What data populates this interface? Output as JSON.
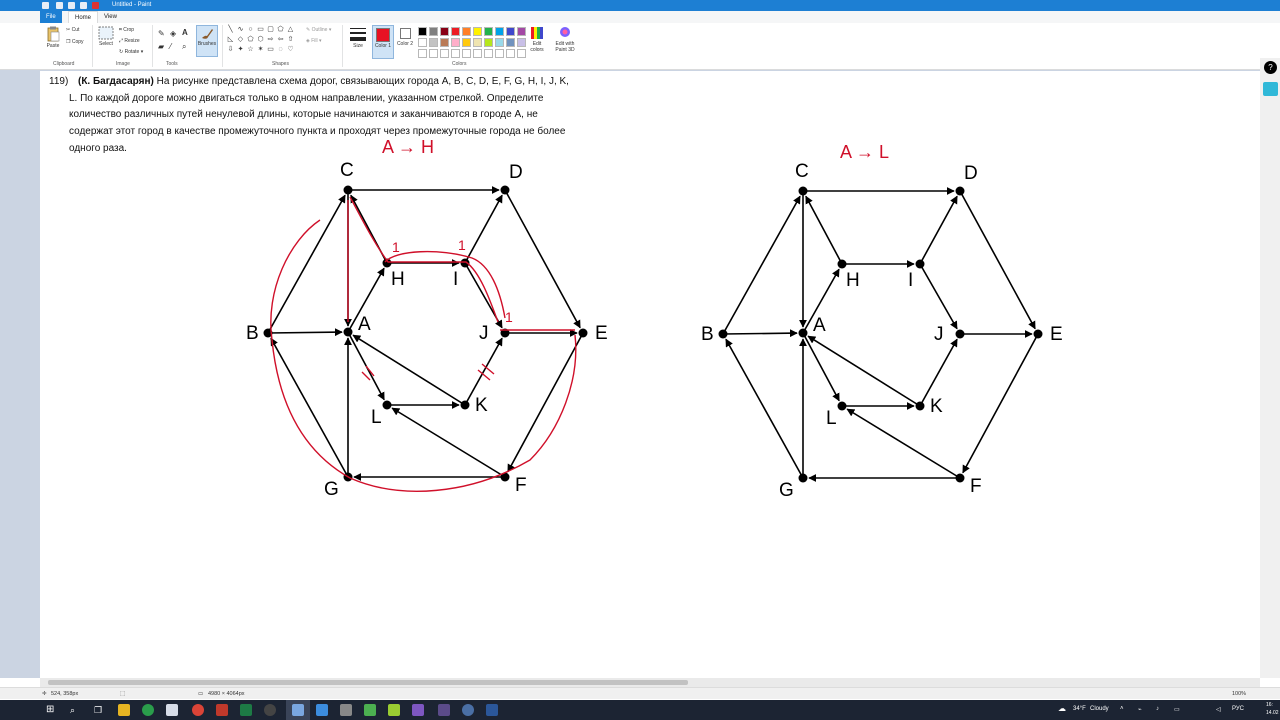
{
  "window": {
    "title": "Untitled - Paint"
  },
  "tabs": [
    {
      "label": "File"
    },
    {
      "label": "Home"
    },
    {
      "label": "View"
    }
  ],
  "ribbon": {
    "clipboard": {
      "paste": "Paste",
      "cut": "Cut",
      "copy": "Copy",
      "group": "Clipboard"
    },
    "image": {
      "select": "Select",
      "crop": "Crop",
      "resize": "Resize",
      "rotate": "Rotate",
      "group": "Image"
    },
    "tools": {
      "group": "Tools",
      "text_tool": "A"
    },
    "brushes": {
      "label": "Brushes"
    },
    "shapes": {
      "group": "Shapes",
      "outline": "Outline",
      "fill": "Fill"
    },
    "size": {
      "label": "Size"
    },
    "colors": {
      "color1": "Color 1",
      "color2": "Color 2",
      "group": "Colors",
      "edit_colors": "Edit colors",
      "edit_3d": "Edit with Paint 3D",
      "color1_value": "#e81123",
      "color2_value": "#ffffff",
      "palette": [
        "#000000",
        "#7f7f7f",
        "#880015",
        "#ed1c24",
        "#ff7f27",
        "#fff200",
        "#22b14c",
        "#00a2e8",
        "#3f48cc",
        "#a349a4",
        "#ffffff",
        "#c3c3c3",
        "#b97a57",
        "#ffaec9",
        "#ffc90e",
        "#efe4b0",
        "#b5e61d",
        "#99d9ea",
        "#7092be",
        "#c8bfe7"
      ]
    }
  },
  "problem": {
    "number": "119)",
    "author": "(К. Багдасарян)",
    "text": "На рисунке представлена схема дорог, связывающих города A, B, C, D, E, F, G, H, I, J, K, L. По каждой дороге можно двигаться только в одном направлении, указанном стрелкой. Определите количество различных путей ненулевой длины, которые начинаются и заканчиваются в городе A, не содержат этот город в качестве промежуточного пункта и проходят через промежуточные города не более одного раза."
  },
  "annotations": {
    "left": "A → H",
    "right": "A → L",
    "marks": [
      "1",
      "1",
      "1"
    ]
  },
  "graph": {
    "labels": [
      "A",
      "B",
      "C",
      "D",
      "E",
      "F",
      "G",
      "H",
      "I",
      "J",
      "K",
      "L"
    ]
  },
  "statusbar": {
    "cursor": "524, 358px",
    "size": "4980 × 4064px",
    "zoom": "100%"
  },
  "taskbar": {
    "weather_temp": "34°F",
    "weather_text": "Cloudy",
    "lang": "РУС",
    "time": "16:",
    "date": "14.02"
  }
}
